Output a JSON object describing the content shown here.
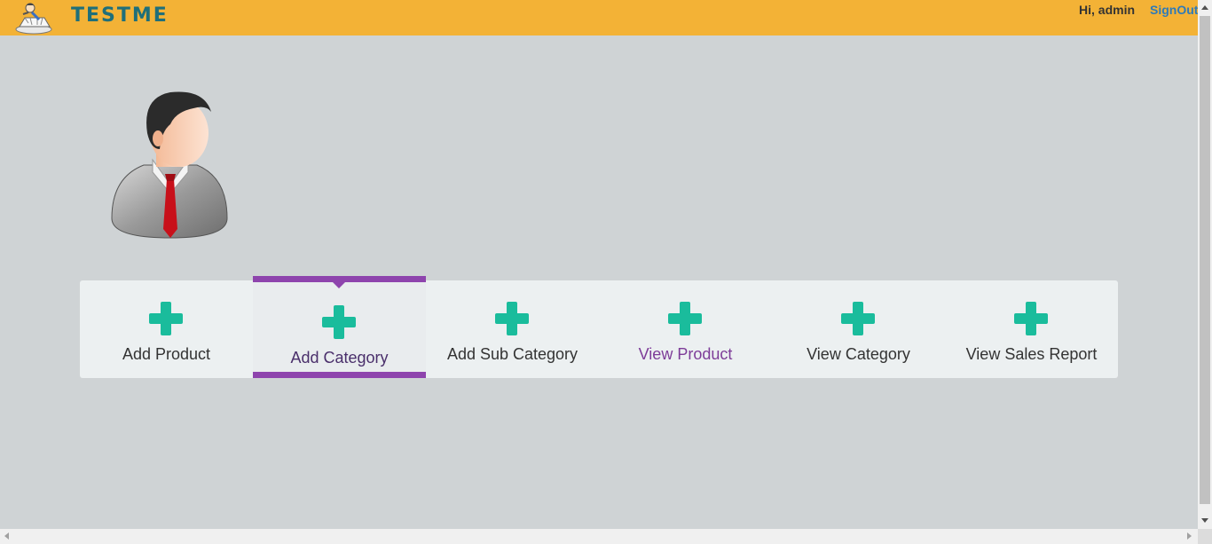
{
  "header": {
    "logo_text": "TESTME",
    "logo_icon": "shopping-cart-mascot-icon",
    "greeting": "Hi, admin",
    "signout_label": "SignOut"
  },
  "profile": {
    "avatar_icon": "user-avatar-icon"
  },
  "menu": {
    "active_index": 1,
    "items": [
      {
        "label": "Add Product",
        "icon": "plus-icon"
      },
      {
        "label": "Add Category",
        "icon": "plus-icon"
      },
      {
        "label": "Add Sub Category",
        "icon": "plus-icon"
      },
      {
        "label": "View Product",
        "icon": "plus-icon"
      },
      {
        "label": "View Category",
        "icon": "plus-icon"
      },
      {
        "label": "View Sales Report",
        "icon": "plus-icon"
      }
    ]
  },
  "colors": {
    "header_bg": "#f3b236",
    "page_bg": "#cfd3d5",
    "menu_bg": "#ecf0f1",
    "accent": "#8e44ad",
    "plus": "#1abc9c",
    "logo_text": "#1f6f7a",
    "link": "#2f7ab8"
  }
}
